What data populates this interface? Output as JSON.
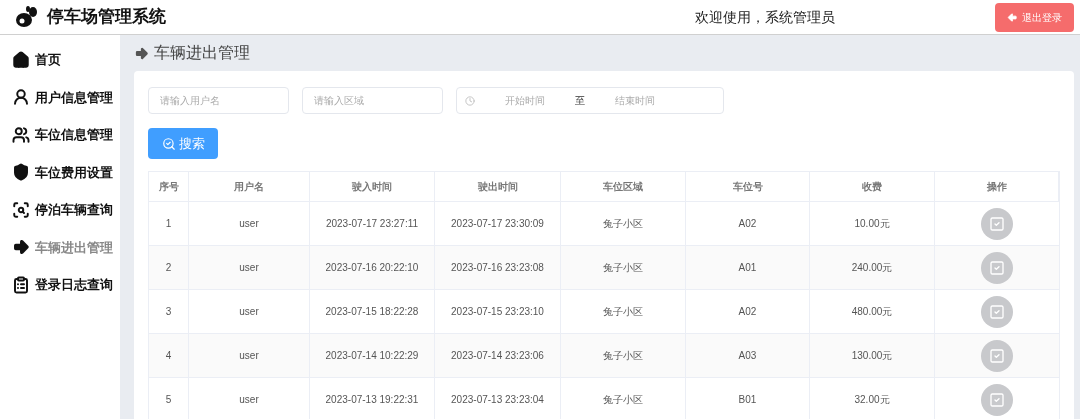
{
  "header": {
    "title": "停车场管理系统",
    "welcome": "欢迎使用，系统管理员",
    "logout": "退出登录"
  },
  "sidebar": {
    "items": [
      {
        "kind": "home",
        "label": "首页",
        "selected": false
      },
      {
        "kind": "user",
        "label": "用户信息管理",
        "selected": false
      },
      {
        "kind": "spot",
        "label": "车位信息管理",
        "selected": false
      },
      {
        "kind": "fee",
        "label": "车位费用设置",
        "selected": false
      },
      {
        "kind": "search",
        "label": "停泊车辆查询",
        "selected": false
      },
      {
        "kind": "arrow",
        "label": "车辆进出管理",
        "selected": true
      },
      {
        "kind": "log",
        "label": "登录日志查询",
        "selected": false
      }
    ]
  },
  "page": {
    "title": "车辆进出管理"
  },
  "filters": {
    "username_placeholder": "请输入用户名",
    "area_placeholder": "请输入区域",
    "start_placeholder": "开始时间",
    "range_separator": "至",
    "end_placeholder": "结束时间",
    "search_button": "搜索"
  },
  "table": {
    "columns": [
      "序号",
      "用户名",
      "驶入时间",
      "驶出时间",
      "车位区域",
      "车位号",
      "收费",
      "操作"
    ],
    "rows": [
      [
        "1",
        "user",
        "2023-07-17 23:27:11",
        "2023-07-17 23:30:09",
        "兔子小区",
        "A02",
        "10.00元"
      ],
      [
        "2",
        "user",
        "2023-07-16 20:22:10",
        "2023-07-16 23:23:08",
        "兔子小区",
        "A01",
        "240.00元"
      ],
      [
        "3",
        "user",
        "2023-07-15 18:22:28",
        "2023-07-15 23:23:10",
        "兔子小区",
        "A02",
        "480.00元"
      ],
      [
        "4",
        "user",
        "2023-07-14 10:22:29",
        "2023-07-14 23:23:06",
        "兔子小区",
        "A03",
        "130.00元"
      ],
      [
        "5",
        "user",
        "2023-07-13 19:22:31",
        "2023-07-13 23:23:04",
        "兔子小区",
        "B01",
        "32.00元"
      ]
    ]
  }
}
